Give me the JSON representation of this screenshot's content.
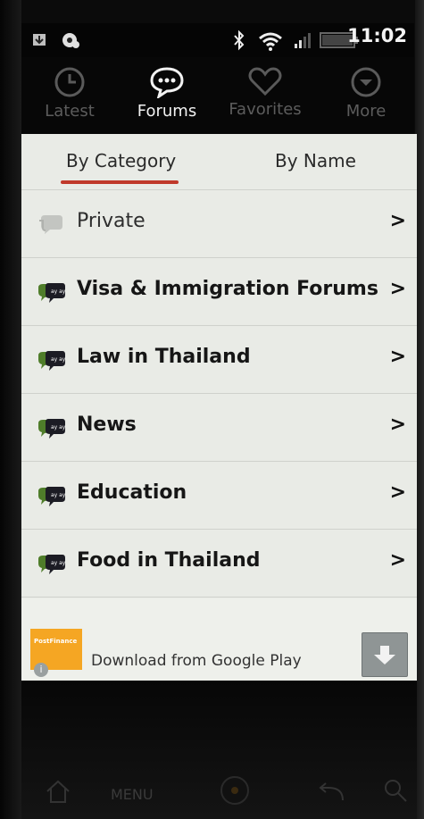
{
  "status_bar": {
    "time": "11:02",
    "icons": [
      "download-icon",
      "notification-icon",
      "bluetooth-icon",
      "wifi-icon",
      "signal-icon",
      "battery-icon"
    ]
  },
  "nav": {
    "tabs": [
      {
        "label": "Latest",
        "icon": "clock-icon",
        "active": false
      },
      {
        "label": "Forums",
        "icon": "chat-bubble-icon",
        "active": true
      },
      {
        "label": "Favorites",
        "icon": "heart-icon",
        "active": false
      },
      {
        "label": "More",
        "icon": "chevron-down-circle-icon",
        "active": false
      }
    ]
  },
  "segments": {
    "by_category": "By Category",
    "by_name": "By Name",
    "active": "By Category"
  },
  "forums": [
    {
      "label": "Private",
      "muted": true
    },
    {
      "label": "Visa & Immigration Forums",
      "muted": false
    },
    {
      "label": "Law in Thailand",
      "muted": false
    },
    {
      "label": "News",
      "muted": false
    },
    {
      "label": "Education",
      "muted": false
    },
    {
      "label": "Food in Thailand",
      "muted": false
    }
  ],
  "chevron": ">",
  "ad": {
    "logo_text": "PostFinance",
    "text": "Download from Google Play",
    "info": "i"
  },
  "hardware": {
    "menu": "MENU"
  },
  "colors": {
    "accent_underline": "#c0392b",
    "panel_bg": "#e9ebe6",
    "ad_logo": "#f5a623"
  }
}
